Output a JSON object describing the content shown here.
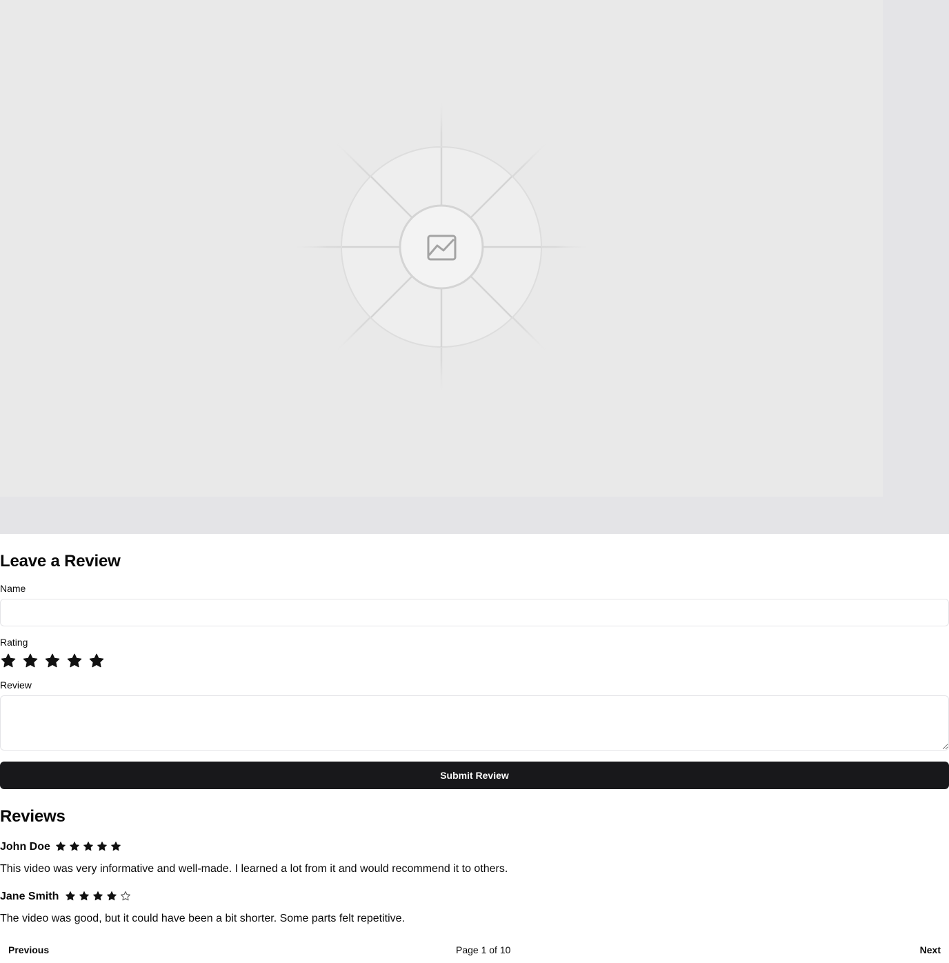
{
  "media": {
    "placeholder_icon": "image-icon"
  },
  "form": {
    "title": "Leave a Review",
    "name_label": "Name",
    "name_value": "",
    "rating_label": "Rating",
    "rating_value": 5,
    "rating_max": 5,
    "review_label": "Review",
    "review_value": "",
    "submit_label": "Submit Review"
  },
  "reviews": {
    "title": "Reviews",
    "items": [
      {
        "name": "John Doe",
        "rating": 5,
        "text": "This video was very informative and well-made. I learned a lot from it and would recommend it to others."
      },
      {
        "name": "Jane Smith",
        "rating": 4,
        "text": "The video was good, but it could have been a bit shorter. Some parts felt repetitive."
      }
    ]
  },
  "pagination": {
    "prev_label": "Previous",
    "info": "Page 1 of 10",
    "next_label": "Next"
  },
  "colors": {
    "button_bg": "#18181b",
    "star_fill": "#111111",
    "border": "#e4e4e7"
  }
}
